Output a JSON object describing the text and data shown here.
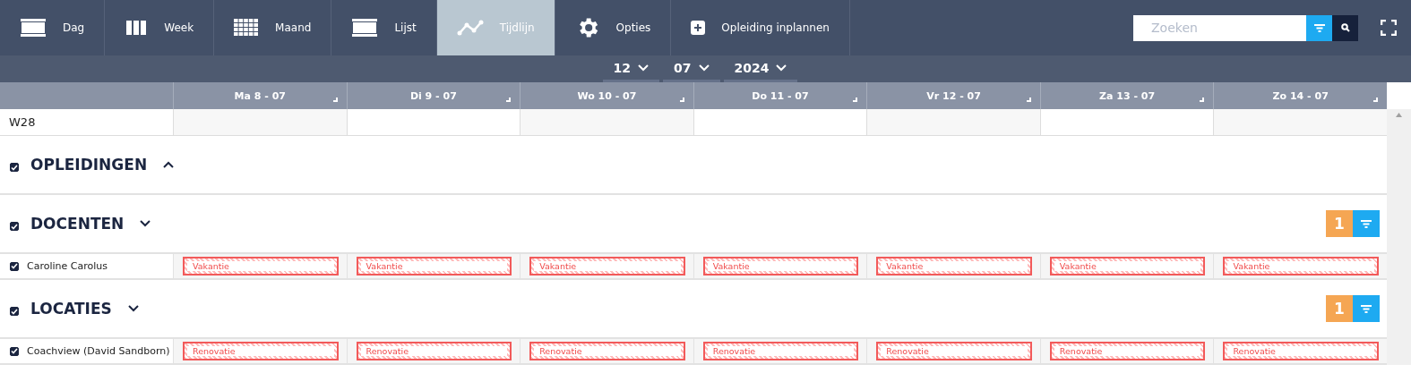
{
  "toolbar": {
    "tabs": [
      {
        "label": "Dag",
        "selected": false
      },
      {
        "label": "Week",
        "selected": false
      },
      {
        "label": "Maand",
        "selected": false
      },
      {
        "label": "Lijst",
        "selected": false
      },
      {
        "label": "Tijdlijn",
        "selected": true
      },
      {
        "label": "Opties",
        "selected": false
      },
      {
        "label": "Opleiding inplannen",
        "selected": false
      }
    ],
    "search": {
      "placeholder": "Zoeken"
    }
  },
  "date_picker": [
    "12",
    "07",
    "2024"
  ],
  "days": [
    "Ma 8 - 07",
    "Di 9 - 07",
    "Wo 10 - 07",
    "Do 11 - 07",
    "Vr 12 - 07",
    "Za 13 - 07",
    "Zo 14 - 07"
  ],
  "week": "W28",
  "sections": [
    {
      "title": "OPLEIDINGEN",
      "checked": true,
      "expanded": true
    },
    {
      "title": "DOCENTEN",
      "checked": true,
      "expanded": false,
      "badge": "1",
      "rows": [
        {
          "name": "Caroline Carolus",
          "checked": true,
          "events": [
            "Vakantie",
            "Vakantie",
            "Vakantie",
            "Vakantie",
            "Vakantie",
            "Vakantie",
            "Vakantie"
          ]
        }
      ]
    },
    {
      "title": "LOCATIES",
      "checked": true,
      "expanded": false,
      "badge": "1",
      "rows": [
        {
          "name": "Coachview (David Sandborn)",
          "checked": true,
          "events": [
            "Renovatie",
            "Renovatie",
            "Renovatie",
            "Renovatie",
            "Renovatie",
            "Renovatie",
            "Renovatie"
          ]
        }
      ]
    }
  ]
}
